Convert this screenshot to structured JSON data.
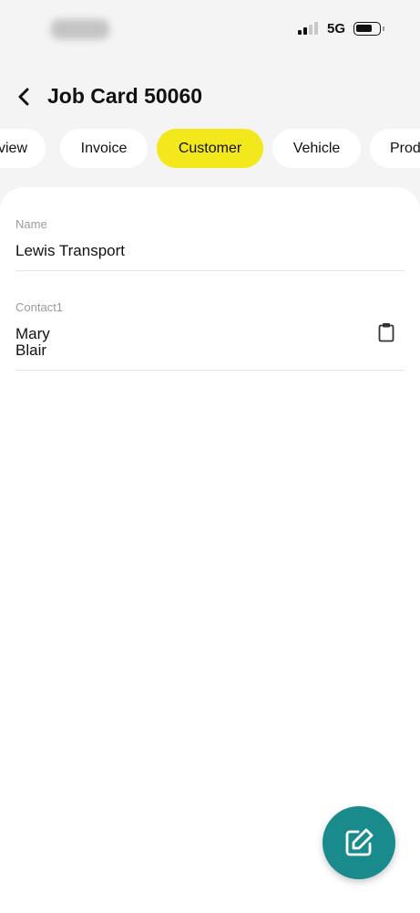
{
  "status_bar": {
    "network": "5G",
    "signal_bars": 2,
    "battery_level": 0.65
  },
  "header": {
    "title": "Job Card 50060",
    "back_icon": "chevron-left-icon"
  },
  "tabs": [
    {
      "label": "Overview",
      "visible_text": "view",
      "active": false
    },
    {
      "label": "Invoice",
      "active": false
    },
    {
      "label": "Customer",
      "active": true
    },
    {
      "label": "Vehicle",
      "active": false
    },
    {
      "label": "Products",
      "visible_text": "Prod",
      "active": false
    }
  ],
  "fields": [
    {
      "label": "Name",
      "value": "Lewis Transport"
    },
    {
      "label": "Contact1",
      "value_lines": [
        "Mary",
        "Blair"
      ],
      "action_icon": "clipboard-icon"
    }
  ],
  "fab": {
    "icon": "edit-icon"
  },
  "colors": {
    "accent_tab": "#f3e81c",
    "fab": "#1a8b8d",
    "background": "#f4f4f4",
    "card": "#ffffff"
  }
}
